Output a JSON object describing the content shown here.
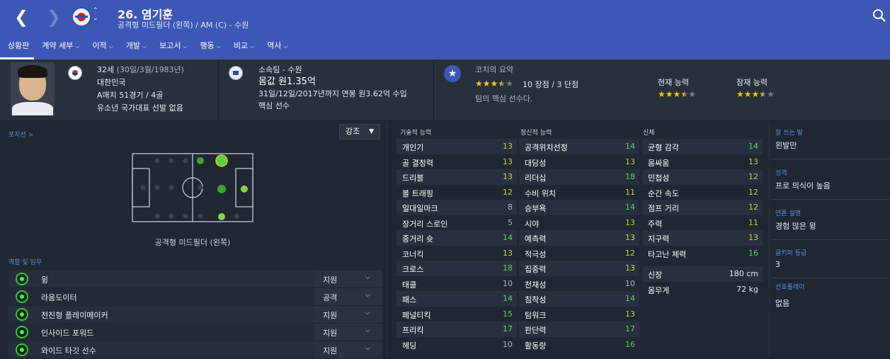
{
  "header": {
    "number_name": "26. 염기훈",
    "position_line": "공격형 미드필더 (왼쪽) / AM (C) - 수원"
  },
  "tabs": [
    {
      "label": "상황판",
      "caret": false
    },
    {
      "label": "계약 세부",
      "caret": true
    },
    {
      "label": "이적",
      "caret": true
    },
    {
      "label": "개발",
      "caret": true
    },
    {
      "label": "보고서",
      "caret": true
    },
    {
      "label": "행동",
      "caret": true
    },
    {
      "label": "비교",
      "caret": true
    },
    {
      "label": "역사",
      "caret": true
    }
  ],
  "info": {
    "age": "32세",
    "birth": "(30일/3월/1983년)",
    "nation": "대한민국",
    "caps": "A매치 51경기 / 4골",
    "youth": "유소년 국가대표 선발 없음",
    "club_label": "소속팀 - 수원",
    "value": "몸값 원1.35억",
    "contract": "31일/12일/2017년까지 연봉 원3.62억 수입",
    "squad_status": "핵심 선수",
    "coach_title": "코치의 요약",
    "strengths": "10 장점 / 3 단점",
    "coach_summary": "팀의 핵심 선수다.",
    "current_ability_label": "현재 능력",
    "potential_ability_label": "잠재 능력",
    "coach_stars": 3.5,
    "current_stars": 3.5,
    "potential_stars": 3.5
  },
  "positions": {
    "label": "포지션 >",
    "emphasis": "강조",
    "caption": "공격형 미드필더 (왼쪽)"
  },
  "roles": {
    "label": "역할 및 임무",
    "items": [
      {
        "name": "윙",
        "duty": "지원"
      },
      {
        "name": "라움도이터",
        "duty": "공격"
      },
      {
        "name": "전진형 플레이메이커",
        "duty": "지원"
      },
      {
        "name": "인사이드 포워드",
        "duty": "지원"
      },
      {
        "name": "와이드 타깃 선수",
        "duty": "지원"
      }
    ]
  },
  "attributes": {
    "technical": {
      "title": "기술적 능력",
      "items": [
        {
          "name": "개인기",
          "value": 13
        },
        {
          "name": "골 결정력",
          "value": 13
        },
        {
          "name": "드리블",
          "value": 13
        },
        {
          "name": "볼 트래핑",
          "value": 12
        },
        {
          "name": "일대일마크",
          "value": 8
        },
        {
          "name": "장거리 스로인",
          "value": 5
        },
        {
          "name": "중거리 슛",
          "value": 14
        },
        {
          "name": "코너킥",
          "value": 13
        },
        {
          "name": "크로스",
          "value": 18
        },
        {
          "name": "태클",
          "value": 10
        },
        {
          "name": "패스",
          "value": 14
        },
        {
          "name": "페널티킥",
          "value": 15
        },
        {
          "name": "프리킥",
          "value": 17
        },
        {
          "name": "헤딩",
          "value": 10
        }
      ]
    },
    "mental": {
      "title": "정신적 능력",
      "items": [
        {
          "name": "공격위치선정",
          "value": 14
        },
        {
          "name": "대담성",
          "value": 13
        },
        {
          "name": "리더십",
          "value": 18
        },
        {
          "name": "수비 위치",
          "value": 11
        },
        {
          "name": "승부욕",
          "value": 14
        },
        {
          "name": "시야",
          "value": 13
        },
        {
          "name": "예측력",
          "value": 13
        },
        {
          "name": "적극성",
          "value": 12
        },
        {
          "name": "집중력",
          "value": 13
        },
        {
          "name": "천재성",
          "value": 10
        },
        {
          "name": "침착성",
          "value": 14
        },
        {
          "name": "팀워크",
          "value": 13
        },
        {
          "name": "판단력",
          "value": 17
        },
        {
          "name": "활동량",
          "value": 16
        }
      ]
    },
    "physical": {
      "title": "신체",
      "items": [
        {
          "name": "균형 감각",
          "value": 14
        },
        {
          "name": "몸싸움",
          "value": 13
        },
        {
          "name": "민첩성",
          "value": 12
        },
        {
          "name": "순간 속도",
          "value": 12
        },
        {
          "name": "점프 거리",
          "value": 12
        },
        {
          "name": "주력",
          "value": 11
        },
        {
          "name": "지구력",
          "value": 13
        },
        {
          "name": "타고난 체력",
          "value": 16
        }
      ],
      "height_label": "신장",
      "height": "180 cm",
      "weight_label": "몸무게",
      "weight": "72 kg"
    }
  },
  "side": {
    "foot_label": "잘 쓰는 발",
    "foot": "왼발만",
    "personality_label": "성격",
    "personality": "프로 의식이 높음",
    "media_label": "언론 설명",
    "media": "경험 많은 윙",
    "goalkeeper_label": "골키퍼 등급",
    "goalkeeper": "3",
    "preferred_label": "선호플레이",
    "preferred": "없음"
  },
  "colors": {
    "header": "#3c57b5",
    "background": "#1f2733",
    "accent_label": "#5f8fdc",
    "star": "#f5c518",
    "attr_high": "#61d05f",
    "attr_mid": "#c8d13c"
  }
}
